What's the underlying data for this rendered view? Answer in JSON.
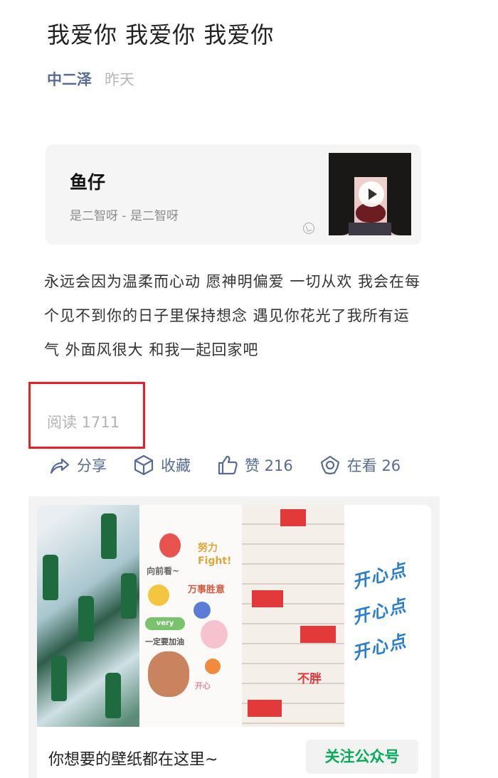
{
  "article": {
    "title": "我爱你 我爱你 我爱你",
    "author": "中二泽",
    "date": "昨天"
  },
  "music": {
    "title": "鱼仔",
    "artist": "是二智呀 - 是二智呀"
  },
  "body": {
    "paragraph": "永远会因为温柔而心动 愿神明偏爱 一切从欢 我会在每个见不到你的日子里保持想念 遇见你花光了我所有运气 外面风很大 和我一起回家吧"
  },
  "stats": {
    "read_label": "阅读 1711"
  },
  "actions": {
    "share_label": "分享",
    "favorite_label": "收藏",
    "like_label": "赞 216",
    "watching_label": "在看 26"
  },
  "ad": {
    "caption": "你想要的壁纸都在这里~",
    "follow_label": "关注公众号",
    "stickers": {
      "fight": "努力 Fight!",
      "forward": "向前看~",
      "wanshi": "万事胜意",
      "very_good": "very Good",
      "jiayou": "一定要加油",
      "kaixin": "开心",
      "bupang": "不胖",
      "kaixindiandian": "开心点"
    }
  },
  "colors": {
    "link_blue": "#576b95",
    "highlight_red": "#e8202b",
    "follow_green": "#06ad56"
  }
}
